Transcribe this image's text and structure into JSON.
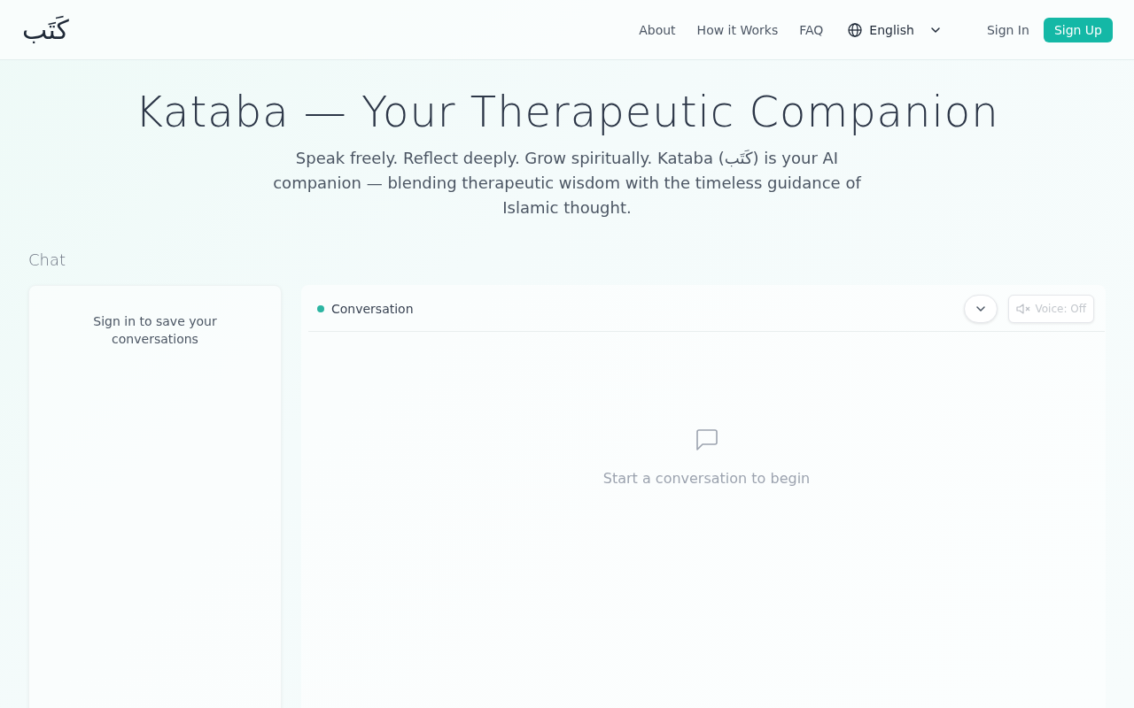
{
  "header": {
    "logo": "كَتَب",
    "nav": [
      "About",
      "How it Works",
      "FAQ"
    ],
    "language": {
      "value": "English"
    },
    "sign_in": "Sign In",
    "sign_up": "Sign Up"
  },
  "hero": {
    "title": "Kataba — Your Therapeutic Companion",
    "subtitle": "Speak freely. Reflect deeply. Grow spiritually. Kataba (كَتَب) is your AI companion — blending therapeutic wisdom with the timeless guidance of Islamic thought."
  },
  "chat": {
    "heading": "Chat",
    "sidebar": {
      "message": "Sign in to save your conversations"
    },
    "conversation": {
      "title": "Conversation",
      "voice_button": {
        "label": "Voice: Off",
        "disabled": true
      },
      "empty_state": "Start a conversation to begin"
    }
  }
}
